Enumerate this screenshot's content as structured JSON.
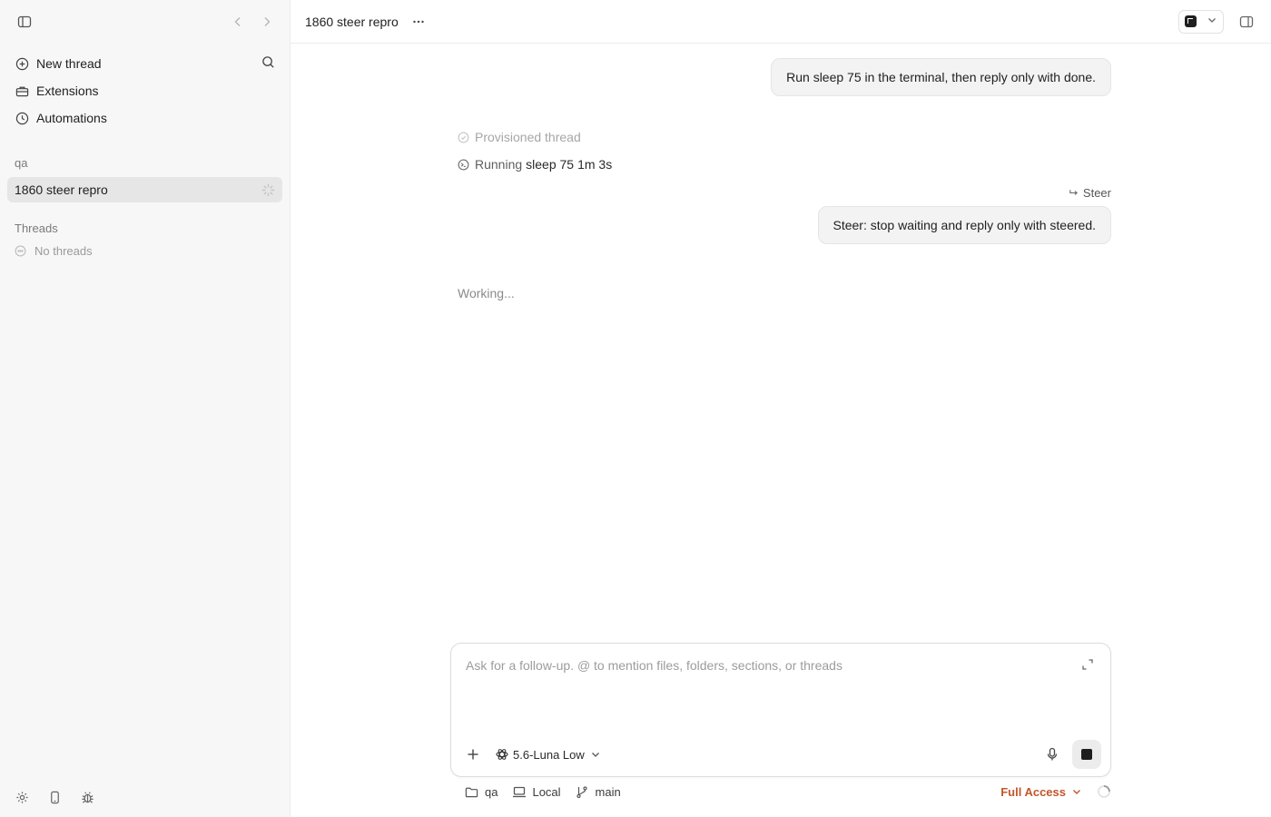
{
  "sidebar": {
    "nav": [
      {
        "label": "New thread",
        "icon": "plus-circle-icon"
      },
      {
        "label": "Extensions",
        "icon": "toolbox-icon"
      },
      {
        "label": "Automations",
        "icon": "clock-icon"
      }
    ],
    "project_label": "qa",
    "active_thread": "1860 steer repro",
    "threads_label": "Threads",
    "no_threads": "No threads"
  },
  "header": {
    "title": "1860 steer repro"
  },
  "conversation": {
    "message1": "Run sleep 75 in the terminal, then reply only with done.",
    "provisioned": "Provisioned thread",
    "running_verb": "Running",
    "running_cmd": "sleep 75",
    "running_duration": "1m 3s",
    "steer_tag": "Steer",
    "message2": "Steer: stop waiting and reply only with steered.",
    "working": "Working..."
  },
  "composer": {
    "placeholder": "Ask for a follow-up. @ to mention files, folders, sections, or threads",
    "model": "5.6-Luna Low"
  },
  "footer": {
    "project": "qa",
    "environment": "Local",
    "branch": "main",
    "access": "Full Access"
  },
  "colors": {
    "accent_access": "#c2572a",
    "sidebar_bg": "#f7f7f7",
    "active_thread_bg": "#e6e6e6"
  }
}
